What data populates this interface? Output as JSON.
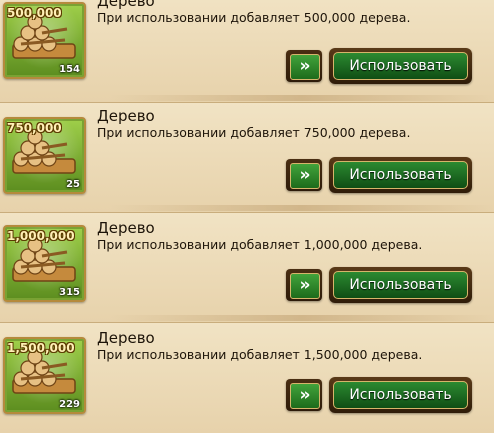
{
  "items": [
    {
      "amount": "500,000",
      "count": "154",
      "title": "Дерево",
      "description": "При использовании добавляет 500,000 дерева.",
      "arrow_label": "»",
      "use_label": "Использовать"
    },
    {
      "amount": "750,000",
      "count": "25",
      "title": "Дерево",
      "description": "При использовании добавляет 750,000 дерева.",
      "arrow_label": "»",
      "use_label": "Использовать"
    },
    {
      "amount": "1,000,000",
      "count": "315",
      "title": "Дерево",
      "description": "При использовании добавляет 1,000,000 дерева.",
      "arrow_label": "»",
      "use_label": "Использовать"
    },
    {
      "amount": "1,500,000",
      "count": "229",
      "title": "Дерево",
      "description": "При использовании добавляет 1,500,000 дерева.",
      "arrow_label": "»",
      "use_label": "Использовать"
    }
  ],
  "colors": {
    "panel": "#ecdcb8",
    "button_green": "#1f7a22",
    "icon_green": "#86b83a",
    "gold_border": "#c9a24b"
  },
  "icons": {
    "item": "wood-logs-icon",
    "arrow": "double-chevron-right-icon"
  }
}
